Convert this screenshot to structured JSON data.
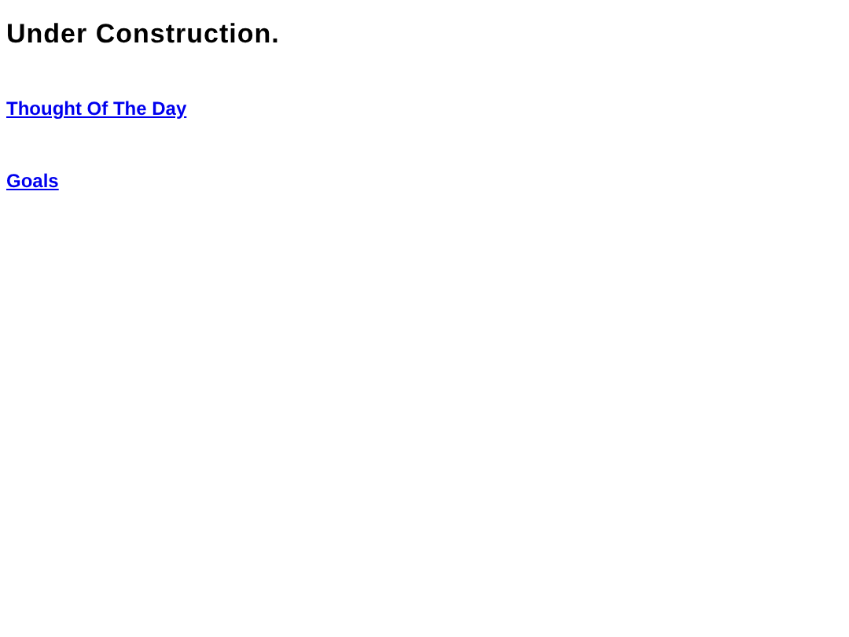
{
  "heading": "Under Construction.",
  "links": [
    {
      "label": "Thought Of The Day"
    },
    {
      "label": "Goals"
    }
  ]
}
